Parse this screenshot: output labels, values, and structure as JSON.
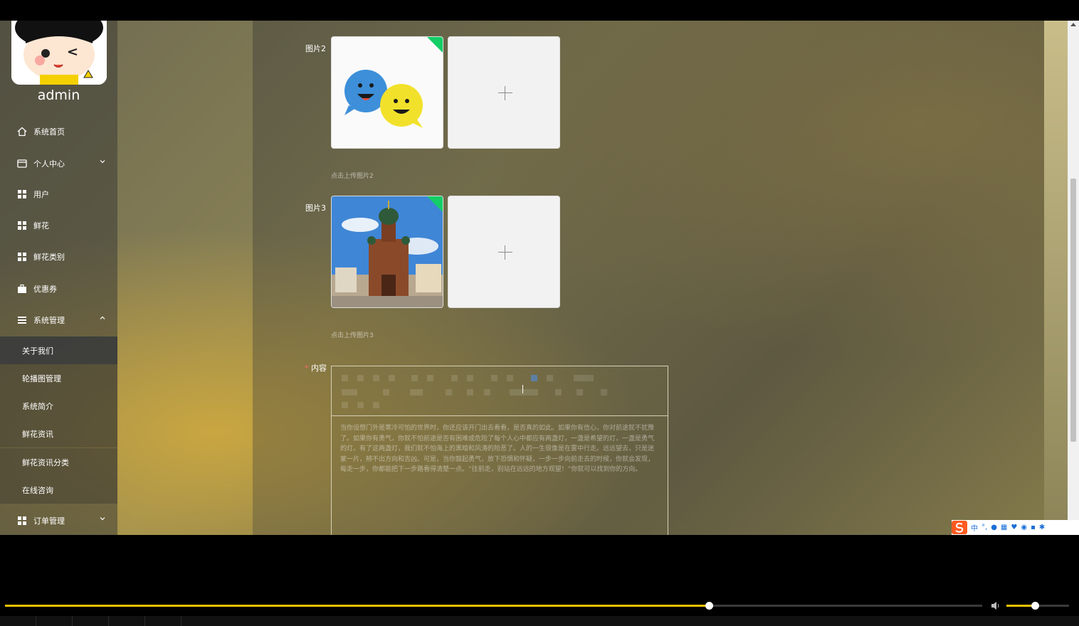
{
  "sidebar": {
    "username": "admin",
    "items": [
      {
        "label": "系统首页",
        "icon": "home-icon"
      },
      {
        "label": "个人中心",
        "icon": "profile-icon",
        "expandable": true
      },
      {
        "label": "用户",
        "icon": "grid-icon"
      },
      {
        "label": "鲜花",
        "icon": "grid-icon"
      },
      {
        "label": "鲜花类别",
        "icon": "grid-icon"
      },
      {
        "label": "优惠券",
        "icon": "briefcase-icon"
      },
      {
        "label": "系统管理",
        "icon": "list-icon",
        "expanded": true
      },
      {
        "label": "订单管理",
        "icon": "grid-icon",
        "expandable": true
      }
    ],
    "submenu": [
      {
        "label": "关于我们",
        "active": true
      },
      {
        "label": "轮播图管理"
      },
      {
        "label": "系统简介"
      },
      {
        "label": "鲜花资讯"
      },
      {
        "label": "鲜花资讯分类"
      },
      {
        "label": "在线咨询"
      }
    ]
  },
  "form": {
    "image2": {
      "label": "图片2",
      "hint": "点击上传图片2"
    },
    "image3": {
      "label": "图片3",
      "hint": "点击上传图片3"
    },
    "content": {
      "required_mark": "*",
      "label": "内容",
      "text": "当你设想门外是寒冷可怕的世界时，你还应该开门出去看看，是否真的如此。如果你有信心，你对前途就不犹豫了。如果你有勇气，你就不怕前途是否有困难或危险了每个人心中都应有两盏灯，一盏是希望的灯，一盏是勇气的灯。有了这两盏灯，我们就不怕海上的黑暗和风涛的险恶了。人的一生很像是在雾中行走。远远望去，只是迷蒙一片，辨不出方向和吉凶。可是，当你鼓起勇气，放下恐惧和怀疑，一步一步向前走去的时候，你就会发现，每走一步，你都能把下一步路看得清楚一点。“往前走，别站在远远的地方观望！”你就可以找到你的方向。"
    }
  },
  "colors": {
    "accent": "#f2c200",
    "upload_success": "#13ce66",
    "required": "#f56c6c"
  },
  "ime": {
    "mode": "中"
  },
  "player": {
    "progress": 0.72,
    "volume": 0.45
  }
}
